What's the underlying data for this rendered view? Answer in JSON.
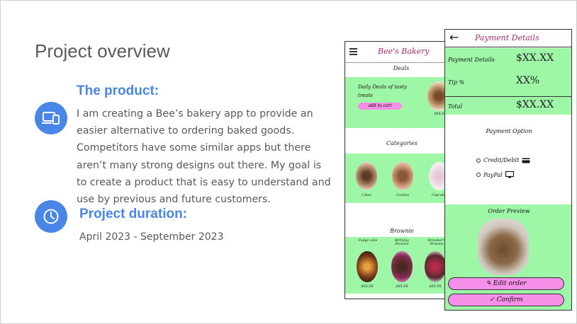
{
  "slide": {
    "title": "Project overview",
    "product": {
      "heading": "The product:",
      "body": "I am creating a Bee’s bakery app to provide an easier alternative to ordering baked goods. Competitors have some similar apps but there aren’t many strong designs out there. My goal is to create a product that is easy to understand and use by previous and future customers."
    },
    "duration": {
      "heading": "Project duration:",
      "dates": "April 2023 - September 2023"
    }
  },
  "phone1": {
    "brand": "Bee's Bakery",
    "deals_heading": "Deals",
    "deal_text": "Daily Deals of tasty treats",
    "add_to_cart": "add to cart",
    "categories_heading": "Categories",
    "category_labels": [
      "Cakes",
      "Cookies",
      "Cupcakes"
    ],
    "brownie_heading": "Brownie",
    "brownie_labels": [
      "Fudge cake",
      "Birthday Brownie",
      "Strawberry Brownie"
    ],
    "price_label": "$XX.XX"
  },
  "phone2": {
    "title": "Payment Details",
    "rows": [
      {
        "label": "Payment Details",
        "value": "$XX.XX"
      },
      {
        "label": "Tip %",
        "value": "XX%"
      },
      {
        "label": "Total",
        "value": "$XX.XX"
      }
    ],
    "payment_option_heading": "Payment Option",
    "options": [
      "Credit/Debit",
      "PayPal"
    ],
    "preview_heading": "Order Preview",
    "edit_label": "Edit order",
    "confirm_label": "Confirm"
  },
  "colors": {
    "accent": "#4a86e8",
    "mint": "#9ef7a6",
    "pink": "#f58fe8",
    "brand": "#a0306e",
    "text": "#595959"
  }
}
